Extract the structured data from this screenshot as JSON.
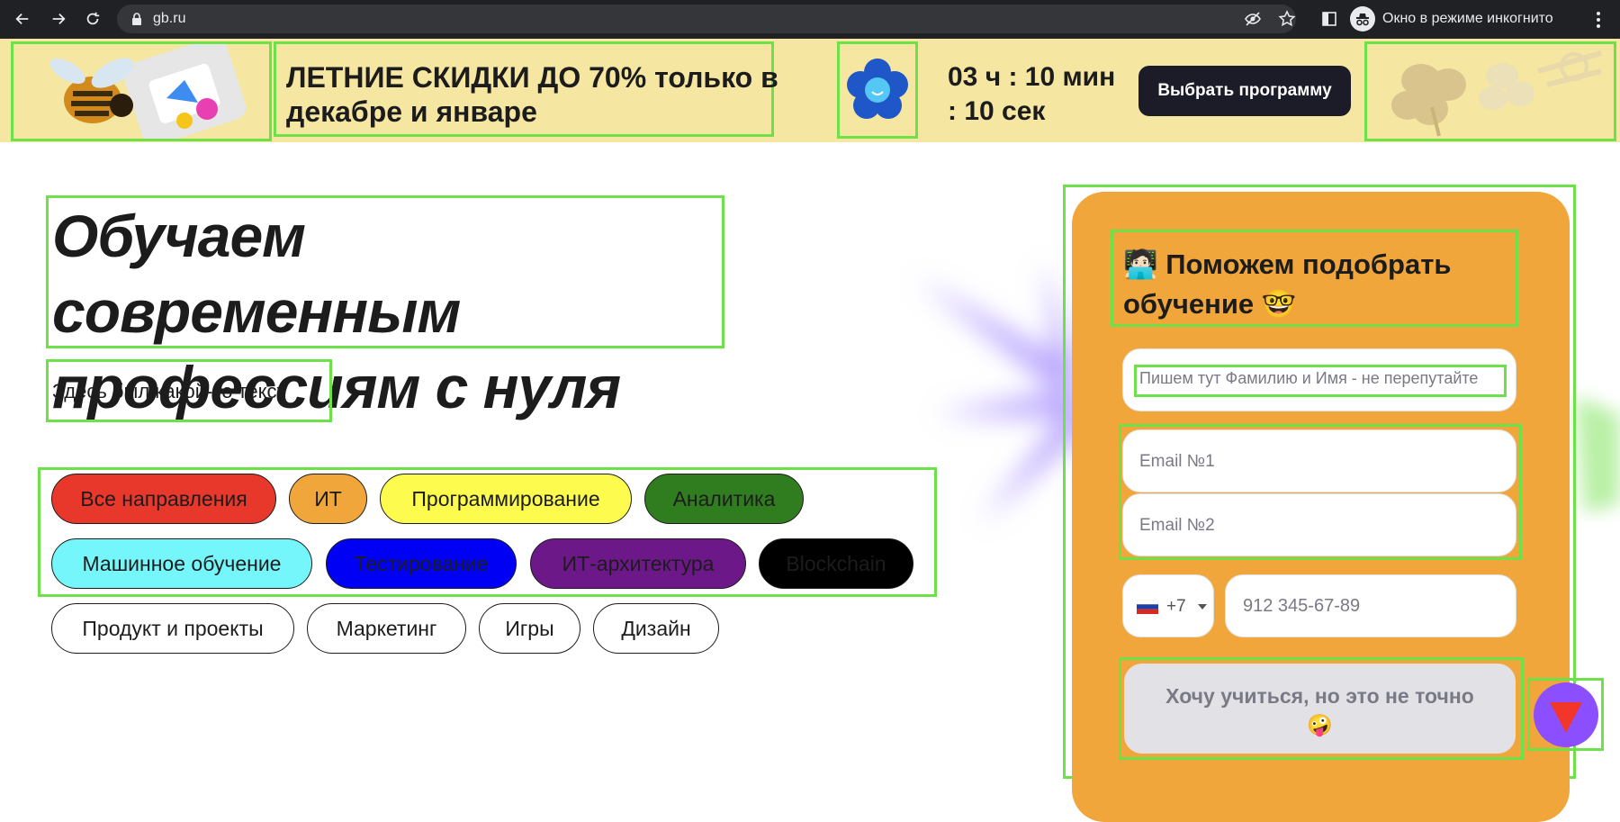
{
  "browser": {
    "url": "gb.ru",
    "incognito_label": "Окно в режиме инкогнито"
  },
  "promo": {
    "title": "ЛЕТНИЕ СКИДКИ ДО 70% только в декабре и январе",
    "timer": "03 ч : 10 мин : 10 сек",
    "button_label": "Выбрать программу"
  },
  "hero": {
    "title": "Обучаем современным профессиям с нуля",
    "subtitle": "Здесь был какой-то текст"
  },
  "chips": [
    {
      "label": "Все направления",
      "color": "#e8372b"
    },
    {
      "label": "ИТ",
      "color": "#f0a63b"
    },
    {
      "label": "Программирование",
      "color": "#fdfc4e"
    },
    {
      "label": "Аналитика",
      "color": "#2f7d1f"
    },
    {
      "label": "Машинное обучение",
      "color": "#74f6fb"
    },
    {
      "label": "Тестирование",
      "color": "#0000f5"
    },
    {
      "label": "ИТ-архитектура",
      "color": "#6d1889"
    },
    {
      "label": "Blockchain",
      "color": "#000000"
    },
    {
      "label": "Продукт и проекты",
      "color": "#ffffff"
    },
    {
      "label": "Маркетинг",
      "color": "#ffffff"
    },
    {
      "label": "Игры",
      "color": "#ffffff"
    },
    {
      "label": "Дизайн",
      "color": "#ffffff"
    }
  ],
  "form": {
    "title_emoji": "🧑🏻‍💻",
    "title": "Поможем подобрать обучение",
    "title_emoji_end": "🤓",
    "name_placeholder": "Пишем тут Фамилию и Имя - не перепутайте",
    "email1_placeholder": "Email №1",
    "email2_placeholder": "Email №2",
    "phone_code": "+7",
    "phone_placeholder": "912 345-67-89",
    "submit_label": "Хочу учиться, но это не точно",
    "submit_emoji": "🤪"
  },
  "colors": {
    "promo_bg": "#f5e6a1",
    "accent_orange": "#f0a63b",
    "highlight_box": "#6ee04a"
  }
}
